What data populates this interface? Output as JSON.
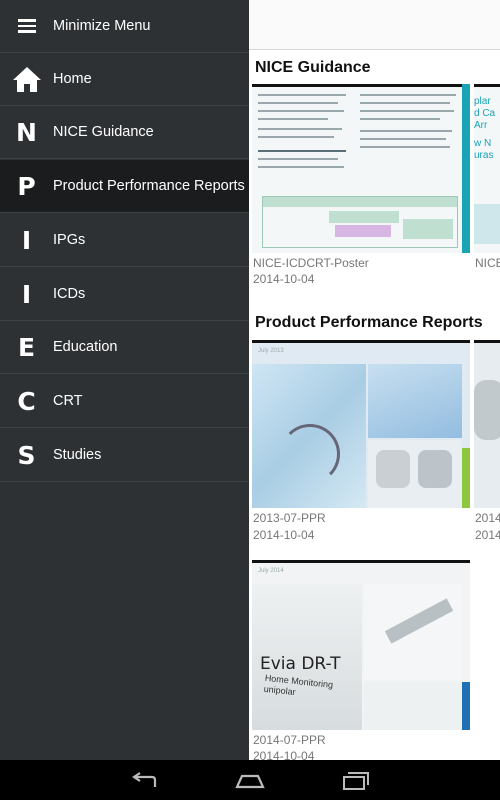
{
  "drawer": {
    "menu_label": "Minimize Menu",
    "items": [
      {
        "letter": "",
        "label": "Home",
        "icon": "home-icon"
      },
      {
        "letter": "N",
        "label": "NICE Guidance"
      },
      {
        "letter": "P",
        "label": "Product Performance Reports",
        "active": true
      },
      {
        "letter": "I",
        "label": "IPGs"
      },
      {
        "letter": "I",
        "label": "ICDs"
      },
      {
        "letter": "E",
        "label": "Education"
      },
      {
        "letter": "C",
        "label": "CRT"
      },
      {
        "letter": "S",
        "label": "Studies"
      }
    ]
  },
  "content": {
    "sections": [
      {
        "title": "NICE Guidance",
        "cards": [
          {
            "name": "NICE-ICDCRT-Poster",
            "date": "2014-10-04"
          },
          {
            "name": "NICE",
            "date": ""
          }
        ]
      },
      {
        "title": "Product Performance Reports",
        "cards": [
          {
            "name": "2013-07-PPR",
            "date": "2014-10-04",
            "badge": "July 2013"
          },
          {
            "name": "2014",
            "date": "2014"
          },
          {
            "name": "2014-07-PPR",
            "date": "2014-10-04",
            "badge": "July 2014",
            "product": "Evia DR-T",
            "subtitle": "Home Monitoring unipolar"
          }
        ]
      }
    ],
    "partial_thumb_text": [
      "plar",
      "d Ca",
      "Arr",
      "w N",
      "uras"
    ]
  },
  "navbar": {
    "buttons": [
      "back-icon",
      "home-icon",
      "recent-apps-icon"
    ]
  },
  "colors": {
    "drawer_bg": "#2d3134",
    "drawer_active": "#1a1c1e",
    "accent_teal": "#1aa3b5"
  }
}
